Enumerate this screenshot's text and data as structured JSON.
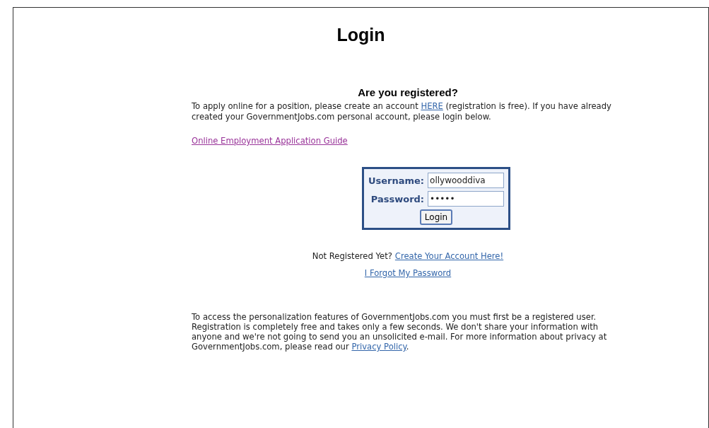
{
  "title": "Login",
  "intro": {
    "heading": "Are you registered?",
    "before": "To apply online for a position, please create an account",
    "link": "HERE",
    "after": "(registration is free). If you have already created your GovernmentJobs.com personal account, please login below."
  },
  "guide_link": "Online Employment Application Guide",
  "login_form": {
    "username_label": "Username:",
    "username_value": "ollywooddiva",
    "password_label": "Password:",
    "password_value": "•••••",
    "button": "Login"
  },
  "register": {
    "prompt": "Not Registered Yet?",
    "link": "Create Your Account Here!",
    "forgot_link": "I Forgot My Password"
  },
  "notice": {
    "text": "To access the personalization features of GovernmentJobs.com you must first be a registered user. Registration is completely free and takes only a few seconds. We don't share your information with anyone and we're not going to send you an unsolicited e-mail. For more information about privacy at GovernmentJobs.com, please read our",
    "link": "Privacy Policy",
    "after": "."
  }
}
